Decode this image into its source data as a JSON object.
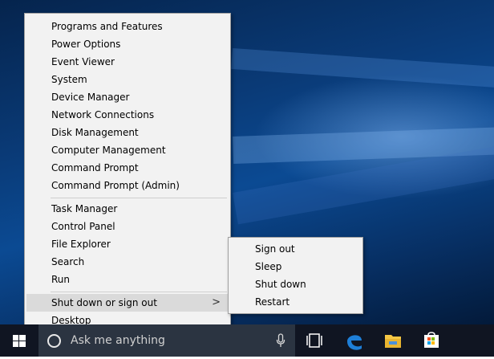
{
  "context_menu": {
    "group1": [
      {
        "label": "Programs and Features"
      },
      {
        "label": "Power Options"
      },
      {
        "label": "Event Viewer"
      },
      {
        "label": "System"
      },
      {
        "label": "Device Manager"
      },
      {
        "label": "Network Connections"
      },
      {
        "label": "Disk Management"
      },
      {
        "label": "Computer Management"
      },
      {
        "label": "Command Prompt"
      },
      {
        "label": "Command Prompt (Admin)"
      }
    ],
    "group2": [
      {
        "label": "Task Manager"
      },
      {
        "label": "Control Panel"
      },
      {
        "label": "File Explorer"
      },
      {
        "label": "Search"
      },
      {
        "label": "Run"
      }
    ],
    "group3": [
      {
        "label": "Shut down or sign out",
        "chevron": ">"
      },
      {
        "label": "Desktop"
      }
    ]
  },
  "submenu": {
    "items": [
      {
        "label": "Sign out"
      },
      {
        "label": "Sleep"
      },
      {
        "label": "Shut down"
      },
      {
        "label": "Restart"
      }
    ]
  },
  "taskbar": {
    "search_placeholder": "Ask me anything",
    "icons": [
      "windows-start-icon",
      "cortana-circle-icon",
      "microphone-icon",
      "task-view-icon",
      "edge-browser-icon",
      "file-explorer-icon",
      "store-icon"
    ]
  },
  "colors": {
    "menu_bg": "#f2f2f2",
    "menu_highlight": "#dadada",
    "taskbar_bg": "#101522",
    "search_bg": "#2b3441",
    "edge_blue": "#1e7fd8",
    "folder_yellow": "#f6c745"
  }
}
